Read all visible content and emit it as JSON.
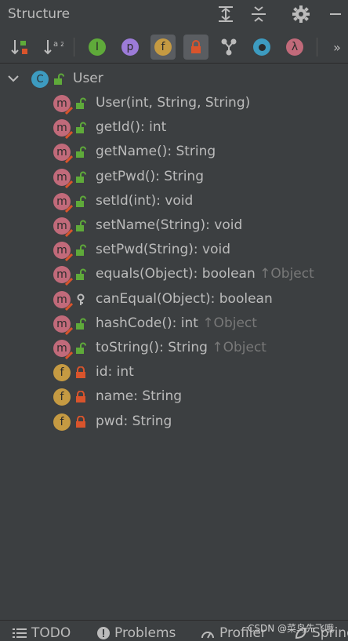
{
  "panel": {
    "title": "Structure",
    "header_icons": [
      "expand-all-icon",
      "collapse-all-icon",
      "gear-icon",
      "minimize-icon"
    ]
  },
  "toolbar": {
    "buttons": [
      {
        "name": "sort-by-visibility",
        "icon": "sort-visibility-icon",
        "active": false
      },
      {
        "name": "sort-alphabetically",
        "icon": "sort-alpha-icon",
        "label": "a z",
        "active": false
      },
      {
        "name": "show-inherited",
        "icon": "inherited-icon",
        "label": "I",
        "active": false
      },
      {
        "name": "show-properties",
        "icon": "property-icon",
        "label": "p",
        "active": false
      },
      {
        "name": "show-fields",
        "icon": "field-icon",
        "label": "f",
        "active": true
      },
      {
        "name": "show-non-public",
        "icon": "lock-icon",
        "active": true
      },
      {
        "name": "show-hierarchy",
        "icon": "hierarchy-icon",
        "active": false
      },
      {
        "name": "show-anonymous",
        "icon": "anonymous-class-icon",
        "active": false
      },
      {
        "name": "show-lambdas",
        "icon": "lambda-icon",
        "label": "λ",
        "active": false
      },
      {
        "name": "more-actions",
        "icon": "more-icon",
        "label": "»",
        "active": false
      }
    ]
  },
  "tree": {
    "root": {
      "label": "User",
      "kind": "c"
    },
    "items": [
      {
        "kind": "m",
        "vis": "public",
        "label": "User(int, String, String)",
        "suffix": ""
      },
      {
        "kind": "m",
        "vis": "public",
        "label": "getId(): int",
        "suffix": ""
      },
      {
        "kind": "m",
        "vis": "public",
        "label": "getName(): String",
        "suffix": ""
      },
      {
        "kind": "m",
        "vis": "public",
        "label": "getPwd(): String",
        "suffix": ""
      },
      {
        "kind": "m",
        "vis": "public",
        "label": "setId(int): void",
        "suffix": ""
      },
      {
        "kind": "m",
        "vis": "public",
        "label": "setName(String): void",
        "suffix": ""
      },
      {
        "kind": "m",
        "vis": "public",
        "label": "setPwd(String): void",
        "suffix": ""
      },
      {
        "kind": "m",
        "vis": "public",
        "label": "equals(Object): boolean",
        "suffix": "↑Object"
      },
      {
        "kind": "m",
        "vis": "protected",
        "label": "canEqual(Object): boolean",
        "suffix": ""
      },
      {
        "kind": "m",
        "vis": "public",
        "label": "hashCode(): int",
        "suffix": "↑Object"
      },
      {
        "kind": "m",
        "vis": "public",
        "label": "toString(): String",
        "suffix": "↑Object"
      },
      {
        "kind": "f",
        "vis": "private",
        "label": "id: int",
        "suffix": ""
      },
      {
        "kind": "f",
        "vis": "private",
        "label": "name: String",
        "suffix": ""
      },
      {
        "kind": "f",
        "vis": "private",
        "label": "pwd: String",
        "suffix": ""
      }
    ]
  },
  "bottom_bar": {
    "items": [
      {
        "label": "TODO",
        "icon": "list-icon"
      },
      {
        "label": "Problems",
        "icon": "problems-icon"
      },
      {
        "label": "Profiler",
        "icon": "profiler-icon"
      },
      {
        "label": "Spring",
        "icon": "spring-icon"
      }
    ]
  },
  "watermark": "CSDN @菜鸟先飞哦",
  "colors": {
    "background": "#3c3f41",
    "method": "#c16a7a",
    "field": "#c59a42",
    "class": "#3d9bc0",
    "public_lock": "#5faa3a",
    "private_lock": "#d9542c",
    "inherited_suffix": "#787878"
  }
}
